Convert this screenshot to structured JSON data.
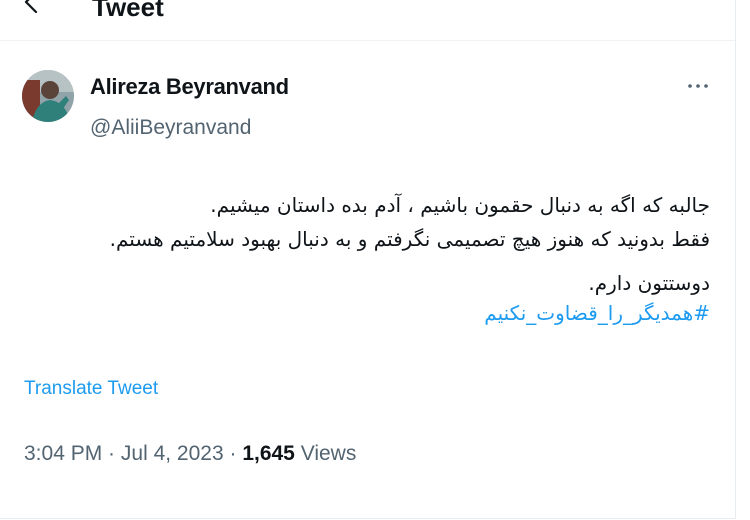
{
  "header": {
    "title": "Tweet"
  },
  "author": {
    "name": "Alireza Beyranvand",
    "handle": "@AliiBeyranvand"
  },
  "tweet": {
    "lines": [
      "جالبه که اگه به دنبال حقمون باشیم ، آدم بده داستان میشیم.",
      "فقط بدونید که هنوز هیچ تصمیمی نگرفتم و به دنبال بهبود سلامتیم هستم.",
      "دوستتون دارم."
    ],
    "hashtag": "#همدیگر_را_قضاوت_نکنیم"
  },
  "translate_label": "Translate Tweet",
  "meta": {
    "time": "3:04 PM",
    "sep1": " · ",
    "date": "Jul 4, 2023",
    "sep2": " · ",
    "views": "1,645",
    "views_label": " Views"
  },
  "icons": {
    "back": "arrow-left-icon",
    "more": "more-horizontal-icon"
  },
  "colors": {
    "accent": "#1d9bf0",
    "text": "#0f1419",
    "secondary": "#536471"
  }
}
